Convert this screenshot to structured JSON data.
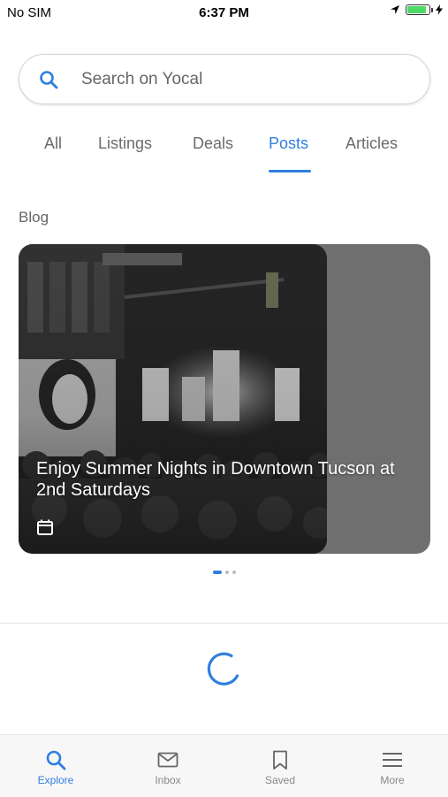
{
  "status_bar": {
    "carrier": "No SIM",
    "time": "6:37 PM",
    "battery_level": 0.9
  },
  "search": {
    "placeholder": "Search on Yocal"
  },
  "tabs": [
    {
      "label": "All",
      "active": false
    },
    {
      "label": "Listings",
      "active": false
    },
    {
      "label": "Deals",
      "active": false
    },
    {
      "label": "Posts",
      "active": true
    },
    {
      "label": "Articles",
      "active": false
    }
  ],
  "section": {
    "title": "Blog"
  },
  "carousel": {
    "cards": [
      {
        "title": "Enjoy Summer Nights in Downtown Tucson at 2nd Saturdays",
        "icon": "calendar-icon"
      }
    ],
    "page_count": 3,
    "active_page": 1
  },
  "bottom_nav": [
    {
      "label": "Explore",
      "icon": "search-icon",
      "active": true
    },
    {
      "label": "Inbox",
      "icon": "mail-icon",
      "active": false
    },
    {
      "label": "Saved",
      "icon": "bookmark-icon",
      "active": false
    },
    {
      "label": "More",
      "icon": "menu-icon",
      "active": false
    }
  ],
  "colors": {
    "accent": "#2f7fe0",
    "battery": "#4cd964"
  }
}
